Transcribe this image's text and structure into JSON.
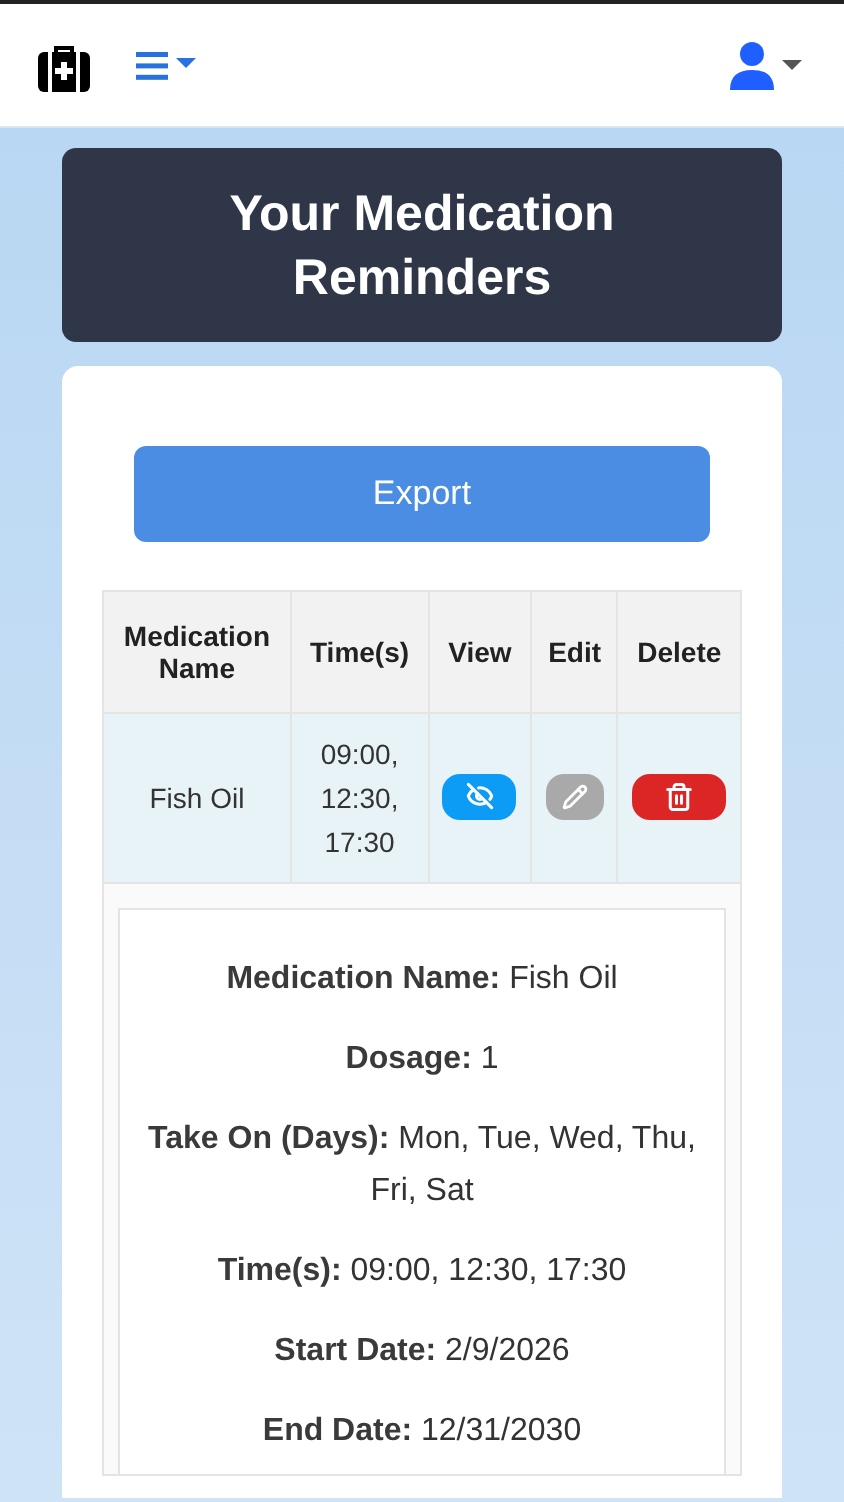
{
  "navbar": {
    "menu_open": false
  },
  "title": "Your Medication Reminders",
  "export_button": "Export",
  "table": {
    "columns": [
      "Medication Name",
      "Time(s)",
      "View",
      "Edit",
      "Delete"
    ],
    "rows": [
      {
        "name": "Fish Oil",
        "times": "09:00, 12:30, 17:30",
        "expanded": true
      }
    ]
  },
  "details": [
    "**Medication Name:**  Fish Oil",
    "**Dosage:**  1",
    "**Take On (Days):**  Mon, Tue, Wed, Thu, Fri, Sat",
    "**Time(s):**  09:00, 12:30, 17:30",
    "**Start Date:**  2/9/2026",
    "**End Date:**  12/31/2030"
  ]
}
